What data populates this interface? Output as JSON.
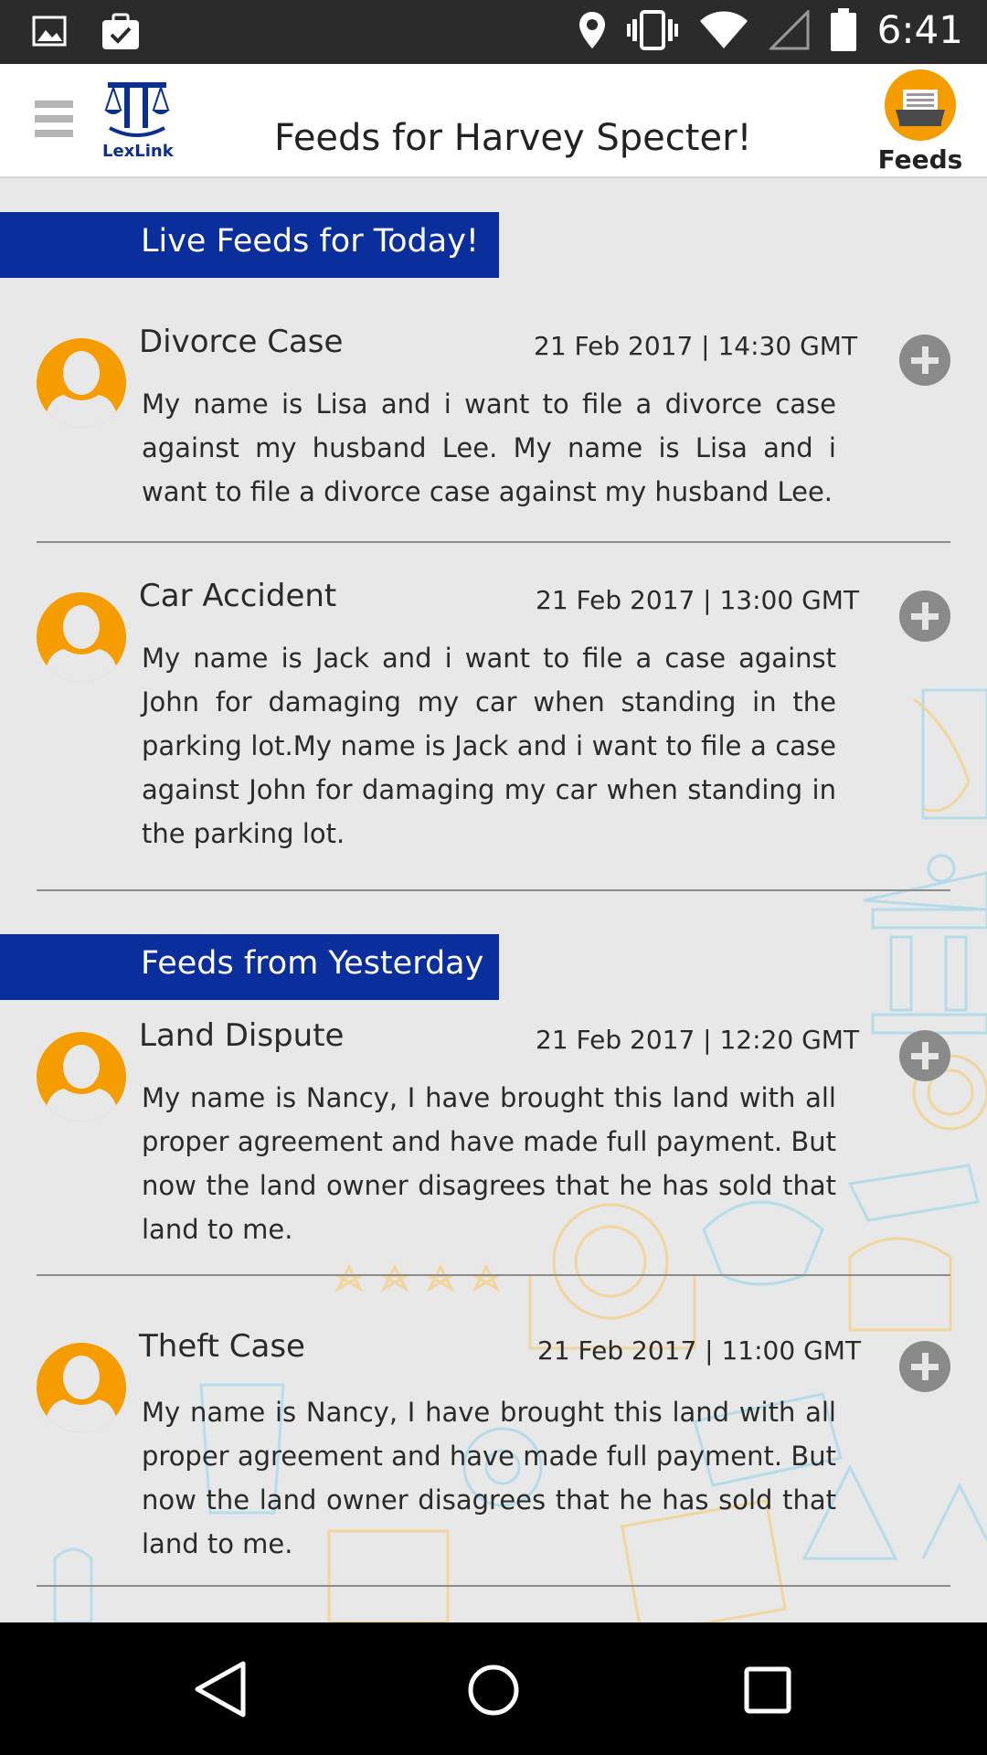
{
  "status_bar": {
    "time": "6:41",
    "icons": [
      "gallery-icon",
      "clipboard-check-icon",
      "location-icon",
      "vibrate-icon",
      "wifi-icon",
      "signal-icon",
      "battery-icon"
    ]
  },
  "header": {
    "logo_text": "LexLink",
    "title": "Feeds for Harvey Specter!",
    "feeds_label": "Feeds"
  },
  "sections": {
    "today": {
      "label": "Live Feeds for Today!",
      "items": [
        {
          "title": "Divorce Case",
          "date": "21 Feb 2017 | 14:30 GMT",
          "body": "My name is Lisa and i want to file a divorce case against my husband Lee. My name is Lisa and i want to file a divorce case against my husband Lee."
        },
        {
          "title": "Car Accident",
          "date": "21 Feb 2017 | 13:00 GMT",
          "body": "My name is Jack and i want to file a case against John for damaging my car when standing in the parking lot.My name is Jack and i want to file a case against John for damaging my car when standing in the parking lot."
        }
      ]
    },
    "yesterday": {
      "label": "Feeds from Yesterday",
      "items": [
        {
          "title": "Land Dispute",
          "date": "21 Feb 2017 | 12:20 GMT",
          "body": "My name is Nancy, I have brought this land with all proper agreement and have made full payment. But now the land owner disagrees that he has sold that land to me."
        },
        {
          "title": "Theft Case",
          "date": "21 Feb 2017 | 11:00 GMT",
          "body": "My name is Nancy, I have brought this land with all proper agreement and have made full payment. But now the land owner disagrees that he has sold that land to me."
        }
      ]
    }
  },
  "colors": {
    "accent_orange": "#f59c00",
    "section_blue": "#0a2f9c",
    "add_button_gray": "#8a8a8a"
  }
}
